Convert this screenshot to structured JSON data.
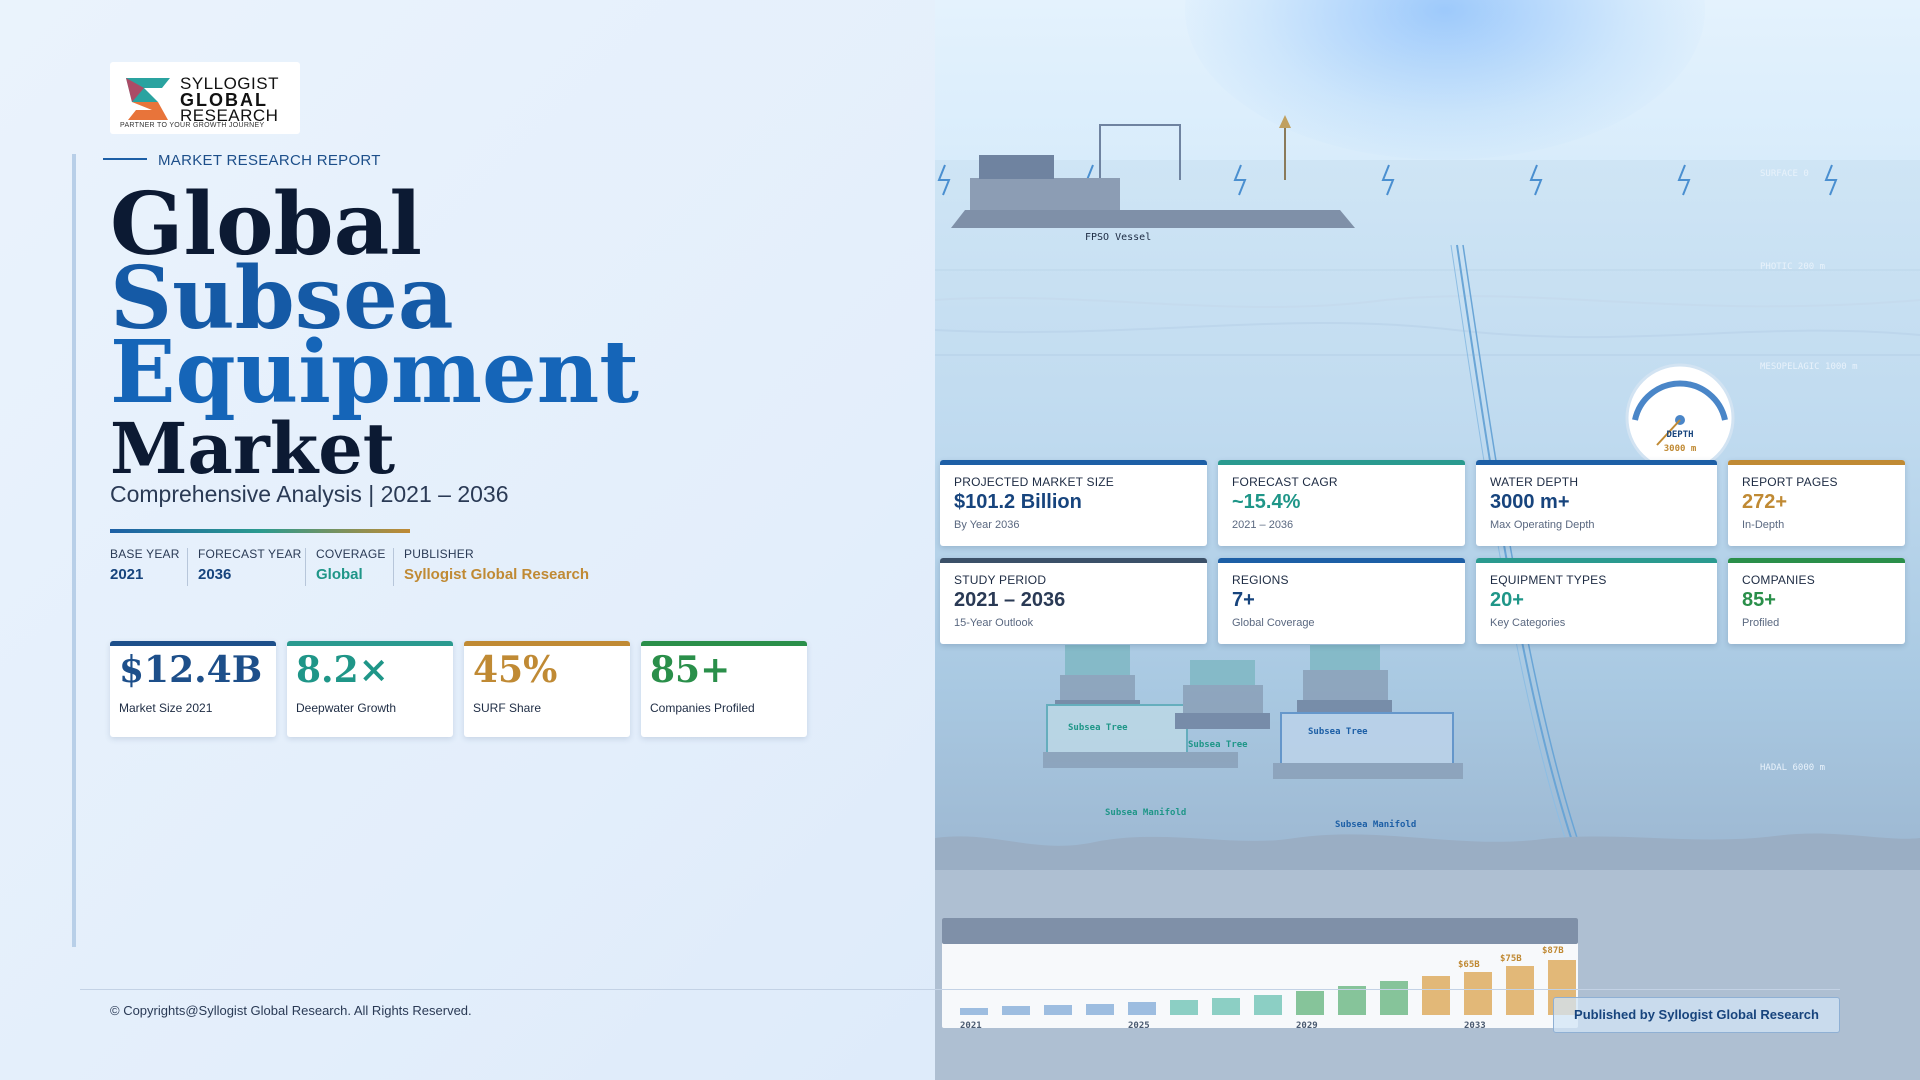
{
  "brand": {
    "line1": "SYLLOGIST",
    "line2": "GLOBAL",
    "line3": "RESEARCH",
    "tagline": "PARTNER TO YOUR GROWTH JOURNEY"
  },
  "eyebrow": "MARKET RESEARCH REPORT",
  "title": {
    "line1": "Global",
    "line2": "Subsea",
    "line3": "Equipment",
    "line4": "Market"
  },
  "subtitle": "Comprehensive Analysis  |  2021 – 2036",
  "meta": [
    {
      "label": "BASE YEAR",
      "value": "2021",
      "color": "#17447d"
    },
    {
      "label": "FORECAST YEAR",
      "value": "2036",
      "color": "#17447d"
    },
    {
      "label": "COVERAGE",
      "value": "Global",
      "color": "#1f9688"
    },
    {
      "label": "PUBLISHER",
      "value": "Syllogist Global Research",
      "color": "#c08a34"
    }
  ],
  "stats": [
    {
      "value": "$12.4B",
      "caption": "Market Size 2021",
      "color": "#1d4f8a"
    },
    {
      "value": "8.2×",
      "caption": "Deepwater Growth",
      "color": "#1f9688"
    },
    {
      "value": "45%",
      "caption": "SURF Share",
      "color": "#c08a34"
    },
    {
      "value": "85+",
      "caption": "Companies Profiled",
      "color": "#2a8f4a"
    }
  ],
  "scene": {
    "fpso_label": "FPSO Vessel",
    "depth_zones": [
      "SURFACE  0",
      "PHOTIC  200 m",
      "MESOPELAGIC  1000 m",
      "HADAL  6000 m"
    ],
    "gauge_label": "DEPTH",
    "gauge_value": "3000 m",
    "equipment_labels": [
      "Subsea Tree",
      "Subsea Tree",
      "Subsea Tree",
      "Subsea Manifold",
      "Subsea Manifold"
    ]
  },
  "kpis": [
    {
      "label": "PROJECTED MARKET SIZE",
      "value": "$101.2 Billion",
      "sub": "By Year 2036",
      "color": "#17447d",
      "bar": "#1d5fa6"
    },
    {
      "label": "FORECAST CAGR",
      "value": "~15.4%",
      "sub": "2021 – 2036",
      "color": "#1f9688",
      "bar": "#2a9a8f"
    },
    {
      "label": "WATER DEPTH",
      "value": "3000 m+",
      "sub": "Max Operating Depth",
      "color": "#17447d",
      "bar": "#1d5fa6"
    },
    {
      "label": "REPORT PAGES",
      "value": "272+",
      "sub": "In-Depth",
      "color": "#c08a34",
      "bar": "#c08a34"
    },
    {
      "label": "STUDY PERIOD",
      "value": "2021 – 2036",
      "sub": "15-Year Outlook",
      "color": "#2a3a55",
      "bar": "#3b5068"
    },
    {
      "label": "REGIONS",
      "value": "7+",
      "sub": "Global Coverage",
      "color": "#17447d",
      "bar": "#1d5fa6"
    },
    {
      "label": "EQUIPMENT TYPES",
      "value": "20+",
      "sub": "Key Categories",
      "color": "#1f9688",
      "bar": "#2a9a8f"
    },
    {
      "label": "COMPANIES",
      "value": "85+",
      "sub": "Profiled",
      "color": "#2a8f4a",
      "bar": "#2a8f4a"
    }
  ],
  "mini_chart": {
    "years": [
      "2021",
      "2025",
      "2029",
      "2033"
    ],
    "value_labels": [
      "$65B",
      "$75B",
      "$87B"
    ]
  },
  "copyright": "©  Copyrights@Syllogist Global Research. All Rights Reserved.",
  "published": "Published by Syllogist Global Research"
}
